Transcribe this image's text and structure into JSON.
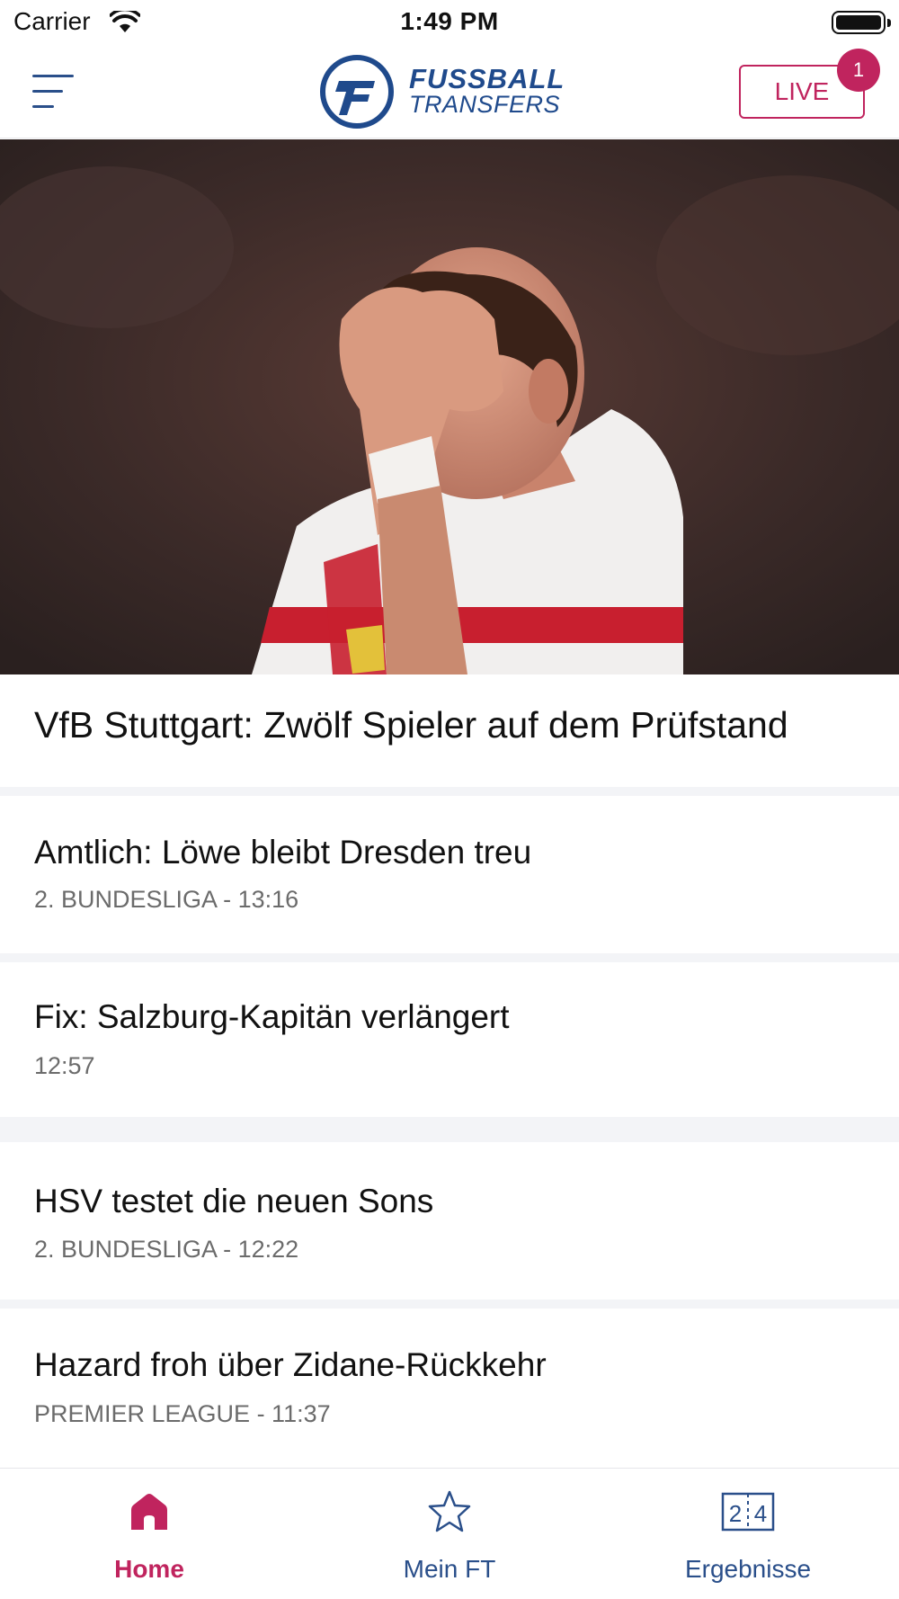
{
  "status_bar": {
    "carrier": "Carrier",
    "time": "1:49 PM"
  },
  "header": {
    "logo_line1": "FUSSBALL",
    "logo_line2": "TRANSFERS",
    "live_label": "LIVE",
    "live_count": "1"
  },
  "hero": {
    "title": "VfB Stuttgart: Zwölf Spieler auf dem Prüfstand"
  },
  "articles": [
    {
      "title": "Amtlich: Löwe bleibt Dresden treu",
      "league": "2. BUNDESLIGA",
      "time": " - 13:16"
    },
    {
      "title": "Fix: Salzburg-Kapitän verlängert",
      "league": "",
      "time": "12:57"
    },
    {
      "title": "HSV testet die neuen Sons",
      "league": "2. BUNDESLIGA",
      "time": " - 12:22"
    },
    {
      "title": "Hazard froh über Zidane-Rückkehr",
      "league": "PREMIER LEAGUE",
      "time": " - 11:37"
    }
  ],
  "tabbar": {
    "home": "Home",
    "mein_ft": "Mein FT",
    "ergebnisse": "Ergebnisse",
    "score_icon_left": "2",
    "score_icon_right": "4"
  },
  "colors": {
    "brand_blue": "#1f4a8c",
    "accent": "#c0245e"
  },
  "icons": [
    "menu-icon",
    "wifi-icon",
    "battery-icon",
    "home-icon",
    "star-icon",
    "scoreboard-icon"
  ]
}
